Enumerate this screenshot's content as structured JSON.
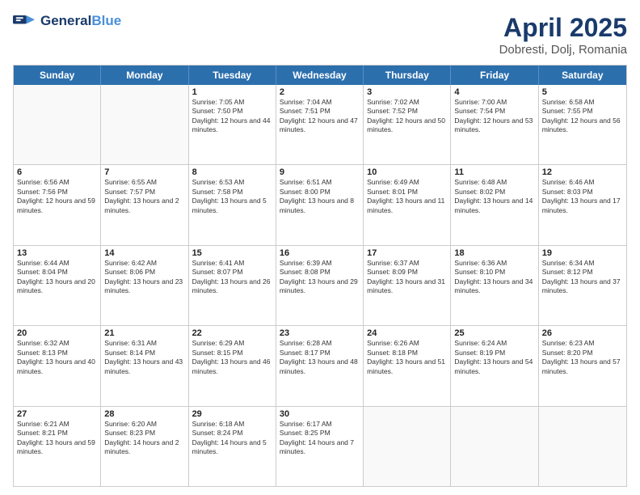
{
  "header": {
    "logo_line1": "General",
    "logo_line2": "Blue",
    "title": "April 2025",
    "subtitle": "Dobresti, Dolj, Romania"
  },
  "days_of_week": [
    "Sunday",
    "Monday",
    "Tuesday",
    "Wednesday",
    "Thursday",
    "Friday",
    "Saturday"
  ],
  "weeks": [
    [
      {
        "day": "",
        "sunrise": "",
        "sunset": "",
        "daylight": ""
      },
      {
        "day": "",
        "sunrise": "",
        "sunset": "",
        "daylight": ""
      },
      {
        "day": "1",
        "sunrise": "Sunrise: 7:05 AM",
        "sunset": "Sunset: 7:50 PM",
        "daylight": "Daylight: 12 hours and 44 minutes."
      },
      {
        "day": "2",
        "sunrise": "Sunrise: 7:04 AM",
        "sunset": "Sunset: 7:51 PM",
        "daylight": "Daylight: 12 hours and 47 minutes."
      },
      {
        "day": "3",
        "sunrise": "Sunrise: 7:02 AM",
        "sunset": "Sunset: 7:52 PM",
        "daylight": "Daylight: 12 hours and 50 minutes."
      },
      {
        "day": "4",
        "sunrise": "Sunrise: 7:00 AM",
        "sunset": "Sunset: 7:54 PM",
        "daylight": "Daylight: 12 hours and 53 minutes."
      },
      {
        "day": "5",
        "sunrise": "Sunrise: 6:58 AM",
        "sunset": "Sunset: 7:55 PM",
        "daylight": "Daylight: 12 hours and 56 minutes."
      }
    ],
    [
      {
        "day": "6",
        "sunrise": "Sunrise: 6:56 AM",
        "sunset": "Sunset: 7:56 PM",
        "daylight": "Daylight: 12 hours and 59 minutes."
      },
      {
        "day": "7",
        "sunrise": "Sunrise: 6:55 AM",
        "sunset": "Sunset: 7:57 PM",
        "daylight": "Daylight: 13 hours and 2 minutes."
      },
      {
        "day": "8",
        "sunrise": "Sunrise: 6:53 AM",
        "sunset": "Sunset: 7:58 PM",
        "daylight": "Daylight: 13 hours and 5 minutes."
      },
      {
        "day": "9",
        "sunrise": "Sunrise: 6:51 AM",
        "sunset": "Sunset: 8:00 PM",
        "daylight": "Daylight: 13 hours and 8 minutes."
      },
      {
        "day": "10",
        "sunrise": "Sunrise: 6:49 AM",
        "sunset": "Sunset: 8:01 PM",
        "daylight": "Daylight: 13 hours and 11 minutes."
      },
      {
        "day": "11",
        "sunrise": "Sunrise: 6:48 AM",
        "sunset": "Sunset: 8:02 PM",
        "daylight": "Daylight: 13 hours and 14 minutes."
      },
      {
        "day": "12",
        "sunrise": "Sunrise: 6:46 AM",
        "sunset": "Sunset: 8:03 PM",
        "daylight": "Daylight: 13 hours and 17 minutes."
      }
    ],
    [
      {
        "day": "13",
        "sunrise": "Sunrise: 6:44 AM",
        "sunset": "Sunset: 8:04 PM",
        "daylight": "Daylight: 13 hours and 20 minutes."
      },
      {
        "day": "14",
        "sunrise": "Sunrise: 6:42 AM",
        "sunset": "Sunset: 8:06 PM",
        "daylight": "Daylight: 13 hours and 23 minutes."
      },
      {
        "day": "15",
        "sunrise": "Sunrise: 6:41 AM",
        "sunset": "Sunset: 8:07 PM",
        "daylight": "Daylight: 13 hours and 26 minutes."
      },
      {
        "day": "16",
        "sunrise": "Sunrise: 6:39 AM",
        "sunset": "Sunset: 8:08 PM",
        "daylight": "Daylight: 13 hours and 29 minutes."
      },
      {
        "day": "17",
        "sunrise": "Sunrise: 6:37 AM",
        "sunset": "Sunset: 8:09 PM",
        "daylight": "Daylight: 13 hours and 31 minutes."
      },
      {
        "day": "18",
        "sunrise": "Sunrise: 6:36 AM",
        "sunset": "Sunset: 8:10 PM",
        "daylight": "Daylight: 13 hours and 34 minutes."
      },
      {
        "day": "19",
        "sunrise": "Sunrise: 6:34 AM",
        "sunset": "Sunset: 8:12 PM",
        "daylight": "Daylight: 13 hours and 37 minutes."
      }
    ],
    [
      {
        "day": "20",
        "sunrise": "Sunrise: 6:32 AM",
        "sunset": "Sunset: 8:13 PM",
        "daylight": "Daylight: 13 hours and 40 minutes."
      },
      {
        "day": "21",
        "sunrise": "Sunrise: 6:31 AM",
        "sunset": "Sunset: 8:14 PM",
        "daylight": "Daylight: 13 hours and 43 minutes."
      },
      {
        "day": "22",
        "sunrise": "Sunrise: 6:29 AM",
        "sunset": "Sunset: 8:15 PM",
        "daylight": "Daylight: 13 hours and 46 minutes."
      },
      {
        "day": "23",
        "sunrise": "Sunrise: 6:28 AM",
        "sunset": "Sunset: 8:17 PM",
        "daylight": "Daylight: 13 hours and 48 minutes."
      },
      {
        "day": "24",
        "sunrise": "Sunrise: 6:26 AM",
        "sunset": "Sunset: 8:18 PM",
        "daylight": "Daylight: 13 hours and 51 minutes."
      },
      {
        "day": "25",
        "sunrise": "Sunrise: 6:24 AM",
        "sunset": "Sunset: 8:19 PM",
        "daylight": "Daylight: 13 hours and 54 minutes."
      },
      {
        "day": "26",
        "sunrise": "Sunrise: 6:23 AM",
        "sunset": "Sunset: 8:20 PM",
        "daylight": "Daylight: 13 hours and 57 minutes."
      }
    ],
    [
      {
        "day": "27",
        "sunrise": "Sunrise: 6:21 AM",
        "sunset": "Sunset: 8:21 PM",
        "daylight": "Daylight: 13 hours and 59 minutes."
      },
      {
        "day": "28",
        "sunrise": "Sunrise: 6:20 AM",
        "sunset": "Sunset: 8:23 PM",
        "daylight": "Daylight: 14 hours and 2 minutes."
      },
      {
        "day": "29",
        "sunrise": "Sunrise: 6:18 AM",
        "sunset": "Sunset: 8:24 PM",
        "daylight": "Daylight: 14 hours and 5 minutes."
      },
      {
        "day": "30",
        "sunrise": "Sunrise: 6:17 AM",
        "sunset": "Sunset: 8:25 PM",
        "daylight": "Daylight: 14 hours and 7 minutes."
      },
      {
        "day": "",
        "sunrise": "",
        "sunset": "",
        "daylight": ""
      },
      {
        "day": "",
        "sunrise": "",
        "sunset": "",
        "daylight": ""
      },
      {
        "day": "",
        "sunrise": "",
        "sunset": "",
        "daylight": ""
      }
    ]
  ]
}
